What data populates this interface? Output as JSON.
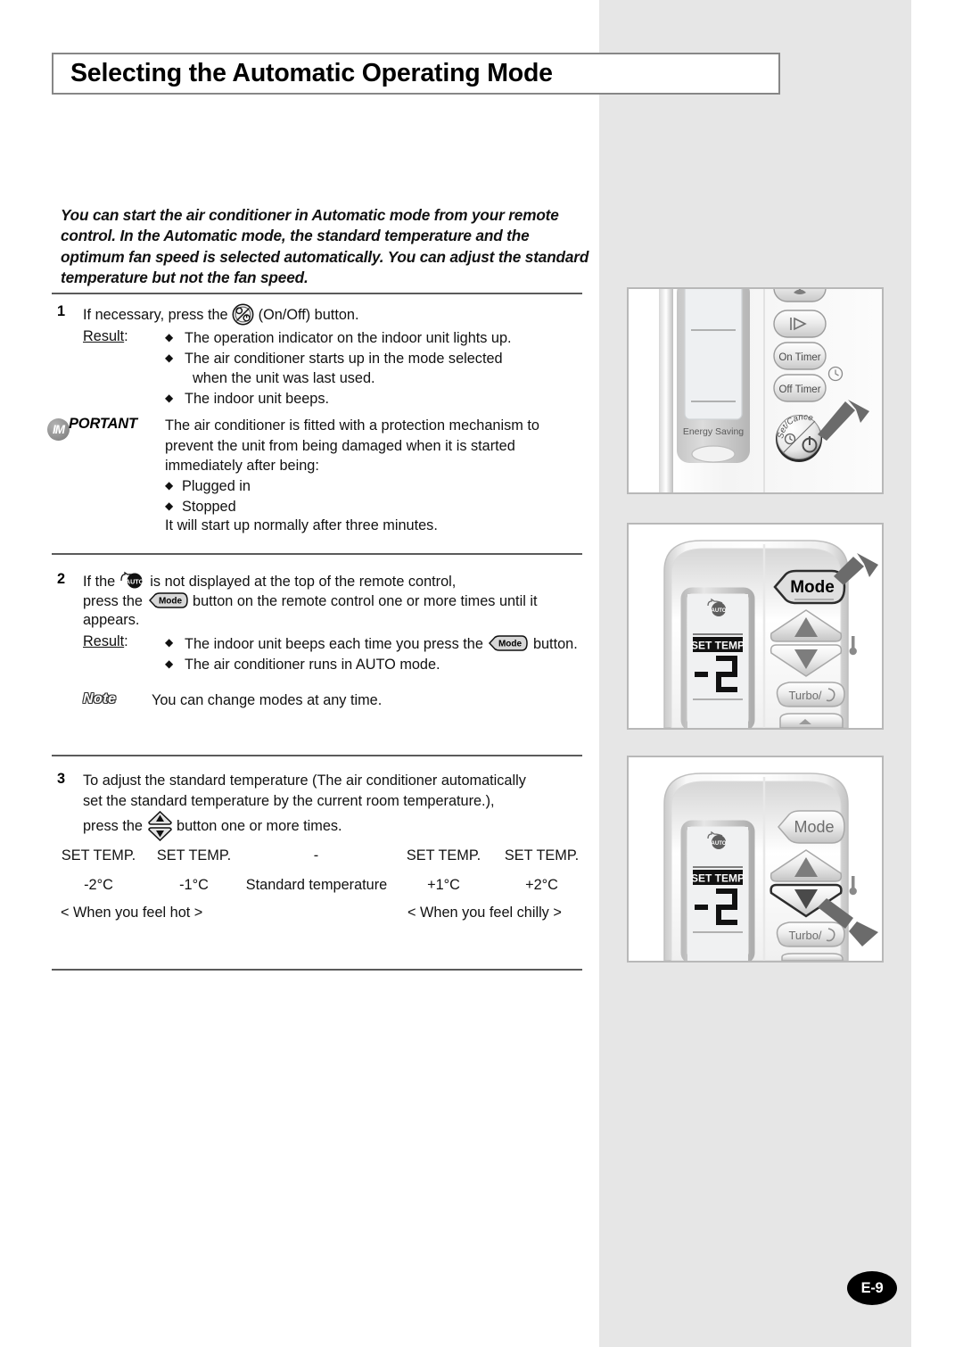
{
  "page": {
    "title": "Selecting the Automatic Operating Mode",
    "page_number": "E-9",
    "intro": "You can start the air conditioner in Automatic mode from your remote control. In the Automatic mode, the standard temperature and the optimum fan speed is selected automatically. You can adjust the standard temperature but not the fan speed."
  },
  "step1": {
    "number": "1",
    "text_before_icon": "If necessary, press the",
    "icon": "on-off-button-icon",
    "text_after_icon": "(On/Off) button.",
    "result_label": "Result",
    "result_colon": ":",
    "bullets": [
      "The operation indicator on the indoor unit lights up.",
      "The air conditioner starts up in the mode selected",
      "when the unit was last used.",
      "The indoor unit beeps."
    ]
  },
  "important": {
    "badge_circle": "IM",
    "badge_rest": "PORTANT",
    "lines": [
      "The air conditioner is fitted with a protection mechanism to",
      "prevent the unit from being damaged when it is started",
      "immediately after being:"
    ],
    "bullets": [
      "Plugged in",
      "Stopped"
    ],
    "closing": "It will start up normally after three minutes."
  },
  "step2": {
    "number": "2",
    "line1_before": "If the",
    "auto_icon": "auto-mode-icon",
    "line1_after": "is not displayed at the top of the remote control,",
    "line2_before": "press the",
    "mode_icon": "mode-button-icon",
    "line2_after": "button on the remote control one or more times until it",
    "line3": "appears.",
    "result_label": "Result",
    "result_colon": ":",
    "bullet1_before": "The indoor unit beeps each time you press the",
    "bullet1_after": "button.",
    "bullet2": "The air conditioner runs in AUTO mode."
  },
  "note": {
    "badge": "Note",
    "text": "You can change modes at any time."
  },
  "step3": {
    "number": "3",
    "line1": "To adjust the standard temperature (The air conditioner automatically",
    "line2": "set the standard temperature by the current room temperature.),",
    "line3_before": "press the",
    "updown_icon": "temp-up-down-button-icon",
    "line3_after": "button one or more times."
  },
  "temp_scale": {
    "top_labels": [
      "SET TEMP.",
      "SET TEMP.",
      "-",
      "SET TEMP.",
      "SET TEMP."
    ],
    "values": [
      "-2°C",
      "-1°C",
      "Standard temperature",
      "+1°C",
      "+2°C"
    ],
    "caption_left": "< When you feel hot >",
    "caption_right": "< When you feel chilly >"
  },
  "illustrations": [
    {
      "name": "remote-onoff-panel",
      "buttons": [
        "On Timer",
        "Off Timer"
      ],
      "display_label": "Energy Saving",
      "dial_label": "Set/Cancel",
      "callout": "arrow-pointer"
    },
    {
      "name": "remote-mode-panel",
      "mode_button": "Mode",
      "turbo_button": "Turbo/",
      "lcd_set_temp": "SET TEMP",
      "lcd_value": "-2",
      "lcd_auto_icon": "auto",
      "callout": "arrow-pointer"
    },
    {
      "name": "remote-temp-panel",
      "mode_button": "Mode",
      "turbo_button": "Turbo/",
      "lcd_set_temp": "SET TEMP",
      "lcd_value": "-2",
      "lcd_auto_icon": "auto",
      "callout": "arrow-pointer"
    }
  ],
  "colors": {
    "band_gray": "#e6e6e6",
    "rule_gray": "#5b5b5b",
    "title_border": "#878787",
    "panel_border": "#b8b8b8"
  }
}
